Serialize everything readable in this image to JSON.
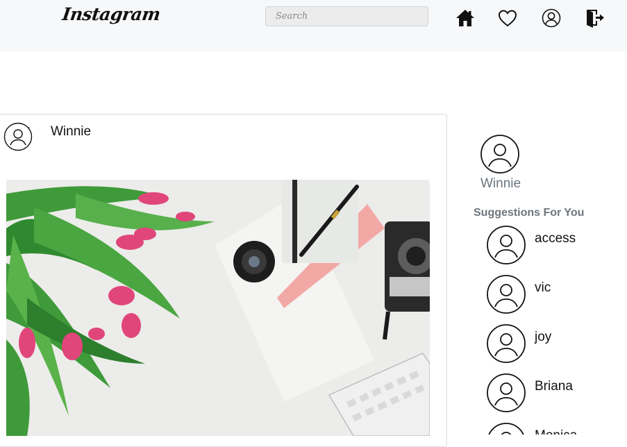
{
  "header": {
    "logo_text": "Instagram",
    "search_placeholder": "Search",
    "icons": [
      "home-icon",
      "heart-icon",
      "profile-icon",
      "logout-icon"
    ]
  },
  "post": {
    "username": "Winnie",
    "photo_description": "flat-lay with pink tulips, camera lens, notebook, pen, camera and keyboard"
  },
  "sidebar": {
    "current_user": "Winnie",
    "suggestions_title": "Suggestions For You",
    "suggestions": [
      {
        "name": "access"
      },
      {
        "name": "vic"
      },
      {
        "name": "joy"
      },
      {
        "name": "Briana"
      },
      {
        "name": "Monica"
      }
    ]
  },
  "colors": {
    "header_bg": "#f7f8fa",
    "muted_text": "#6c757d",
    "border": "#dcdcdc"
  }
}
